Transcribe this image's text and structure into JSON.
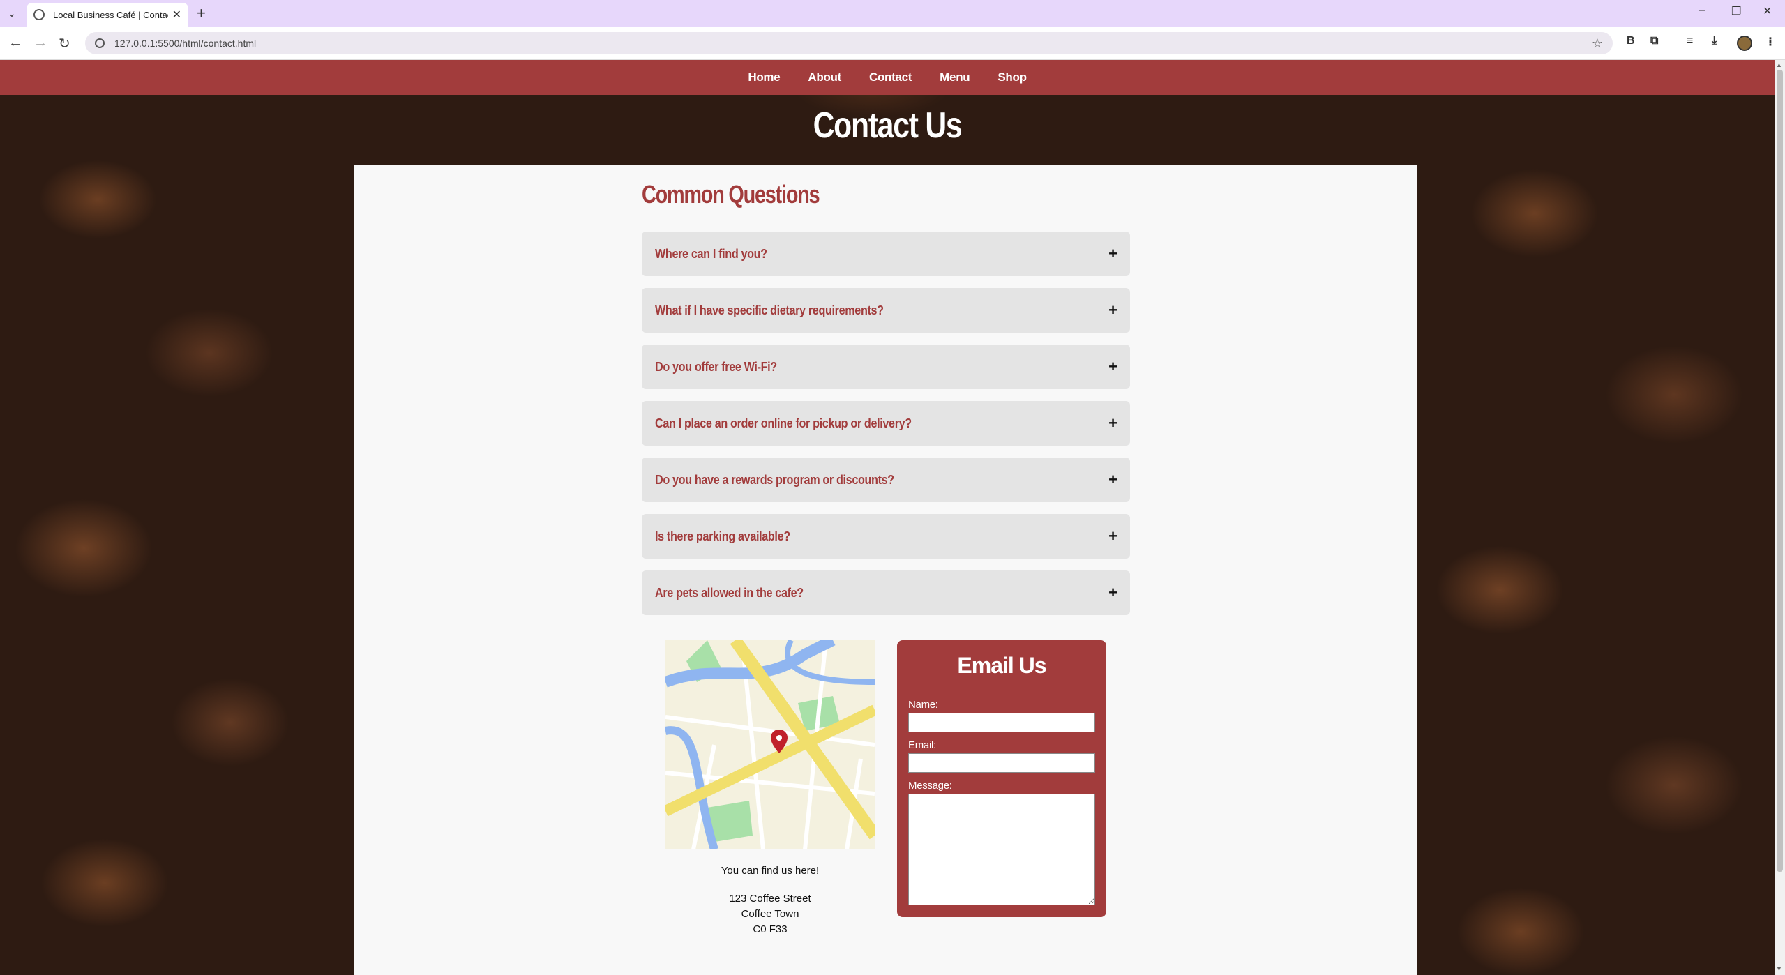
{
  "browser": {
    "tab_title": "Local Business Café | Contact",
    "url": "127.0.0.1:5500/html/contact.html"
  },
  "nav": {
    "items": [
      {
        "label": "Home"
      },
      {
        "label": "About"
      },
      {
        "label": "Contact"
      },
      {
        "label": "Menu"
      },
      {
        "label": "Shop"
      }
    ]
  },
  "page": {
    "title": "Contact Us"
  },
  "faq": {
    "heading": "Common Questions",
    "items": [
      {
        "question": "Where can I find you?",
        "toggle": "+"
      },
      {
        "question": "What if I have specific dietary requirements?",
        "toggle": "+"
      },
      {
        "question": "Do you offer free Wi-Fi?",
        "toggle": "+"
      },
      {
        "question": "Can I place an order online for pickup or delivery?",
        "toggle": "+"
      },
      {
        "question": "Do you have a rewards program or discounts?",
        "toggle": "+"
      },
      {
        "question": "Is there parking available?",
        "toggle": "+"
      },
      {
        "question": "Are pets allowed in the cafe?",
        "toggle": "+"
      }
    ]
  },
  "location": {
    "caption": "You can find us here!",
    "address_line1": "123 Coffee Street",
    "address_line2": "Coffee Town",
    "address_line3": "C0 F33"
  },
  "email_form": {
    "title": "Email Us",
    "name_label": "Name:",
    "email_label": "Email:",
    "message_label": "Message:",
    "name_value": "",
    "email_value": "",
    "message_value": ""
  },
  "colors": {
    "brand": "#a23c3c",
    "tab_bar": "#e7d7fb",
    "panel": "#f8f8f8",
    "faq_item": "#e4e4e4"
  }
}
